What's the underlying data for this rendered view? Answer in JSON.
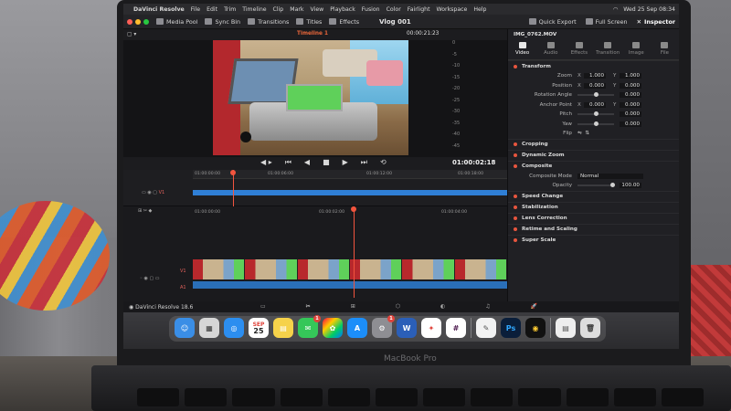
{
  "menubar": {
    "app_name": "DaVinci Resolve",
    "items": [
      "File",
      "Edit",
      "Trim",
      "Timeline",
      "Clip",
      "Mark",
      "View",
      "Playback",
      "Fusion",
      "Color",
      "Fairlight",
      "Workspace",
      "Help"
    ],
    "clock": "Wed 25 Sep  08:34"
  },
  "topbar": {
    "media_pool": "Media Pool",
    "sync_bin": "Sync Bin",
    "transitions": "Transitions",
    "titles": "Titles",
    "effects": "Effects",
    "project": "Vlog 001",
    "quick_export": "Quick Export",
    "full_screen": "Full Screen",
    "inspector": "Inspector"
  },
  "viewer": {
    "timeline_name": "Timeline 1",
    "timecode_top": "00:00:21:23",
    "timecode_current": "01:00:02:18"
  },
  "meters": [
    "0",
    "-5",
    "-10",
    "-15",
    "-20",
    "-25",
    "-30",
    "-35",
    "-40",
    "-45",
    "-50"
  ],
  "upper_ruler": [
    "01:00:00:00",
    "01:00:06:00",
    "01:00:12:00",
    "01:00:18:00"
  ],
  "lower_ruler": [
    "01:00:00:00",
    "01:00:02:00",
    "01:00:04:00"
  ],
  "tracks": {
    "v1": "V1",
    "a1": "A1"
  },
  "inspector": {
    "clip_name": "IMG_0762.MOV",
    "tabs": [
      "Video",
      "Audio",
      "Effects",
      "Transition",
      "Image",
      "File"
    ],
    "transform_title": "Transform",
    "zoom_label": "Zoom",
    "zoom_x": "1.000",
    "zoom_y": "1.000",
    "position_label": "Position",
    "position_x": "0.000",
    "position_y": "0.000",
    "rotation_label": "Rotation Angle",
    "rotation_val": "0.000",
    "anchor_label": "Anchor Point",
    "anchor_x": "0.000",
    "anchor_y": "0.000",
    "pitch_label": "Pitch",
    "pitch_val": "0.000",
    "yaw_label": "Yaw",
    "yaw_val": "0.000",
    "flip_label": "Flip",
    "cropping": "Cropping",
    "dynamic_zoom": "Dynamic Zoom",
    "composite": "Composite",
    "composite_mode_label": "Composite Mode",
    "composite_mode_val": "Normal",
    "opacity_label": "Opacity",
    "opacity_val": "100.00",
    "speed_change": "Speed Change",
    "stabilization": "Stabilization",
    "lens_correction": "Lens Correction",
    "retime_scaling": "Retime and Scaling",
    "super_scale": "Super Scale"
  },
  "pagebar": {
    "version": "DaVinci Resolve 18.6"
  },
  "dock": {
    "calendar_month": "SEP",
    "calendar_day": "25",
    "badge_messages": "1",
    "badge_settings": "1"
  },
  "laptop_brand": "MacBook Pro",
  "colors": {
    "accent": "#e8553e",
    "clip_blue": "#2f7fd6",
    "playhead": "#f2553e"
  }
}
